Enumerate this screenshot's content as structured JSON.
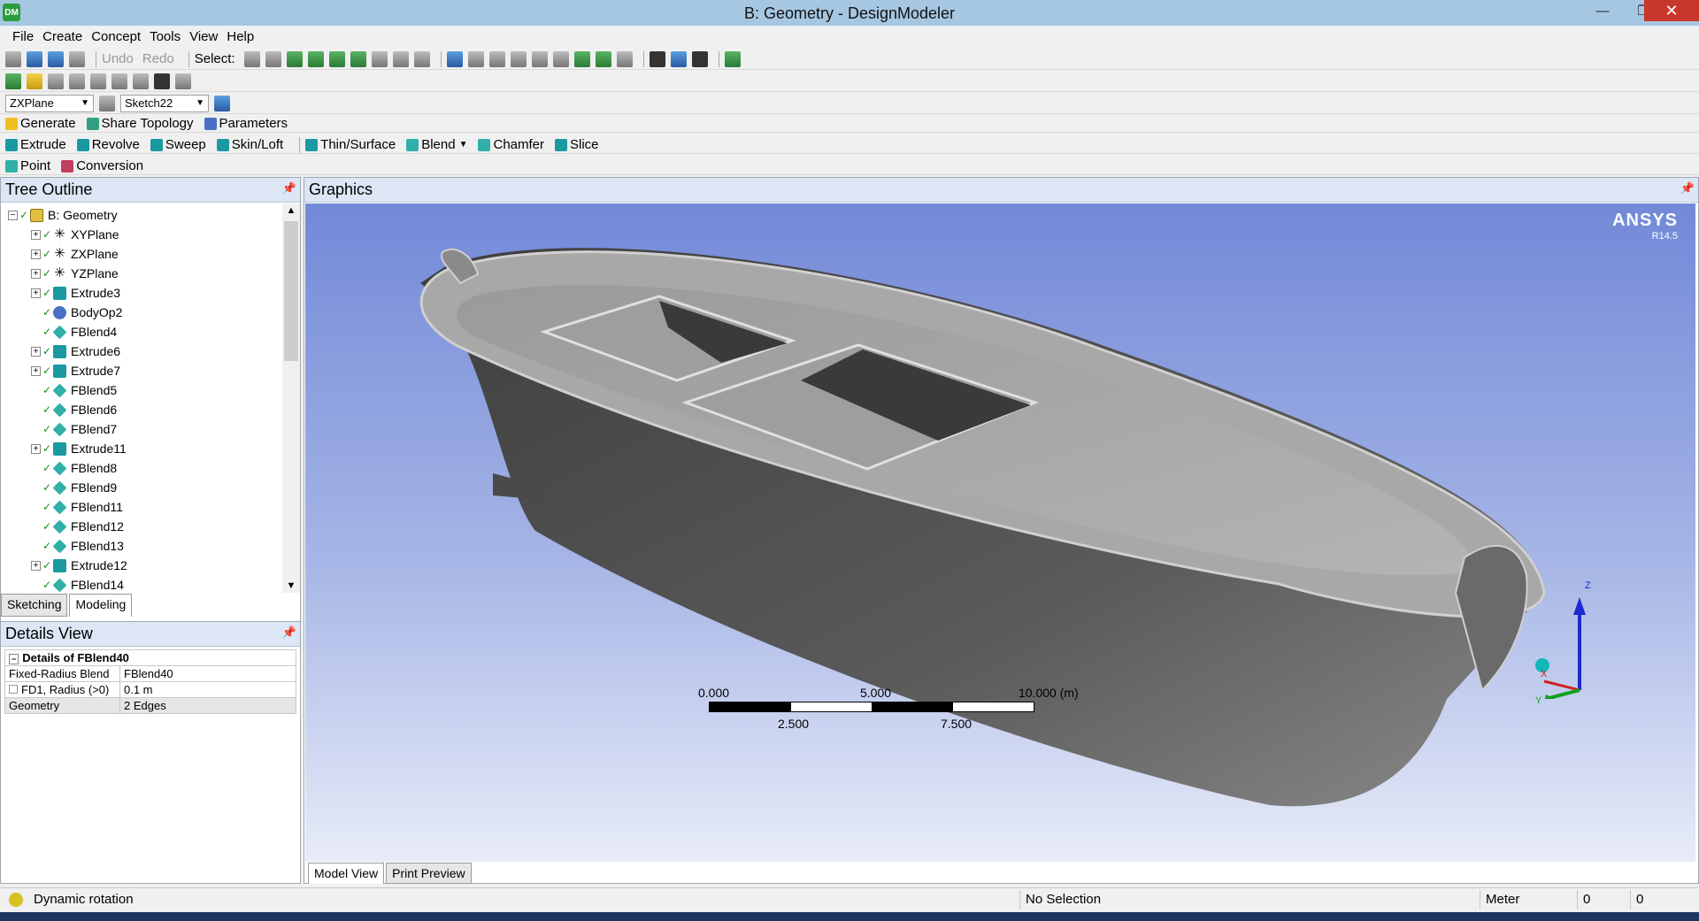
{
  "window": {
    "title": "B: Geometry - DesignModeler",
    "app_icon_text": "DM",
    "minimize_glyph": "—",
    "maximize_glyph": "❐",
    "close_glyph": "✕"
  },
  "menu": [
    "File",
    "Create",
    "Concept",
    "Tools",
    "View",
    "Help"
  ],
  "toolbar": {
    "undo_label": "Undo",
    "redo_label": "Redo",
    "select_label": "Select:"
  },
  "plane_row": {
    "plane_value": "ZXPlane",
    "sketch_value": "Sketch22"
  },
  "features_row": {
    "generate": "Generate",
    "share_topology": "Share Topology",
    "parameters": "Parameters"
  },
  "create_row": {
    "extrude": "Extrude",
    "revolve": "Revolve",
    "sweep": "Sweep",
    "skin_loft": "Skin/Loft",
    "thin_surface": "Thin/Surface",
    "blend": "Blend",
    "chamfer": "Chamfer",
    "slice": "Slice"
  },
  "point_row": {
    "point": "Point",
    "conversion": "Conversion"
  },
  "tree": {
    "title": "Tree Outline",
    "root": "B: Geometry",
    "items": [
      {
        "label": "XYPlane",
        "icon": "plane",
        "expandable": true
      },
      {
        "label": "ZXPlane",
        "icon": "plane",
        "expandable": true
      },
      {
        "label": "YZPlane",
        "icon": "plane",
        "expandable": true
      },
      {
        "label": "Extrude3",
        "icon": "extrude",
        "expandable": true
      },
      {
        "label": "BodyOp2",
        "icon": "bodyop",
        "expandable": false
      },
      {
        "label": "FBlend4",
        "icon": "blend",
        "expandable": false
      },
      {
        "label": "Extrude6",
        "icon": "extrude",
        "expandable": true
      },
      {
        "label": "Extrude7",
        "icon": "extrude",
        "expandable": true
      },
      {
        "label": "FBlend5",
        "icon": "blend",
        "expandable": false
      },
      {
        "label": "FBlend6",
        "icon": "blend",
        "expandable": false
      },
      {
        "label": "FBlend7",
        "icon": "blend",
        "expandable": false
      },
      {
        "label": "Extrude11",
        "icon": "extrude",
        "expandable": true
      },
      {
        "label": "FBlend8",
        "icon": "blend",
        "expandable": false
      },
      {
        "label": "FBlend9",
        "icon": "blend",
        "expandable": false
      },
      {
        "label": "FBlend11",
        "icon": "blend",
        "expandable": false
      },
      {
        "label": "FBlend12",
        "icon": "blend",
        "expandable": false
      },
      {
        "label": "FBlend13",
        "icon": "blend",
        "expandable": false
      },
      {
        "label": "Extrude12",
        "icon": "extrude",
        "expandable": true
      },
      {
        "label": "FBlend14",
        "icon": "blend",
        "expandable": false
      }
    ],
    "tabs": [
      "Sketching",
      "Modeling"
    ],
    "active_tab": "Modeling"
  },
  "details": {
    "title": "Details View",
    "heading": "Details of FBlend40",
    "rows": [
      {
        "label": "Fixed-Radius Blend",
        "value": "FBlend40"
      },
      {
        "label": "FD1,  Radius (>0)",
        "value": "0.1 m"
      },
      {
        "label": "Geometry",
        "value": "2 Edges"
      }
    ]
  },
  "graphics": {
    "title": "Graphics",
    "brand": "ANSYS",
    "version": "R14.5",
    "scale_top": [
      "0.000",
      "5.000",
      "10.000 (m)"
    ],
    "scale_bottom": [
      "2.500",
      "7.500"
    ],
    "axes": {
      "z": "Z",
      "x": "X",
      "y": "Y"
    },
    "tabs": [
      "Model View",
      "Print Preview"
    ],
    "active_tab": "Model View"
  },
  "status": {
    "message": "Dynamic rotation",
    "selection": "No Selection",
    "units": "Meter",
    "coord1": "0",
    "coord2": "0"
  }
}
